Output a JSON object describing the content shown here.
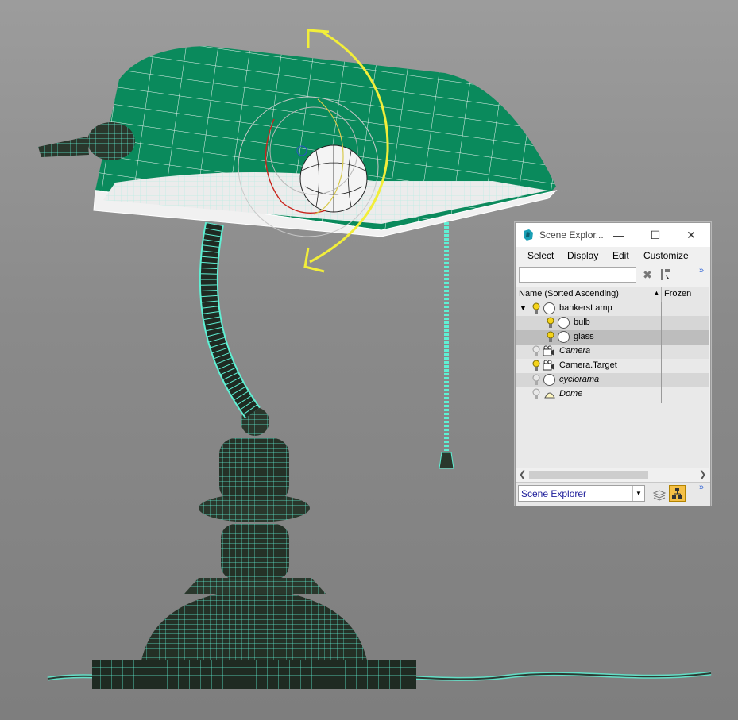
{
  "window": {
    "title": "Scene Explor...",
    "menu": [
      "Select",
      "Display",
      "Edit",
      "Customize"
    ],
    "search_value": "",
    "columns": {
      "name": "Name (Sorted Ascending)",
      "frozen": "Frozen"
    },
    "rows": [
      {
        "label": "bankersLamp",
        "italic": false,
        "selected": false
      },
      {
        "label": "bulb",
        "italic": false,
        "selected": false
      },
      {
        "label": "glass",
        "italic": false,
        "selected": true
      },
      {
        "label": "Camera",
        "italic": true,
        "selected": false
      },
      {
        "label": "Camera.Target",
        "italic": false,
        "selected": false
      },
      {
        "label": "cyclorama",
        "italic": true,
        "selected": false
      },
      {
        "label": "Dome",
        "italic": true,
        "selected": false
      }
    ],
    "explorer_selector": "Scene Explorer",
    "overflow_glyph": "»"
  },
  "colors": {
    "viewport_bg": "#8e8e8e",
    "shade_green": "#0a8a5c",
    "wire": "#5ff0d4",
    "gizmo_yellow": "#f2ee3a",
    "selected_row": "#c9c9c9"
  },
  "icons": {
    "close": "✕",
    "maximize": "☐",
    "minimize": "—"
  }
}
